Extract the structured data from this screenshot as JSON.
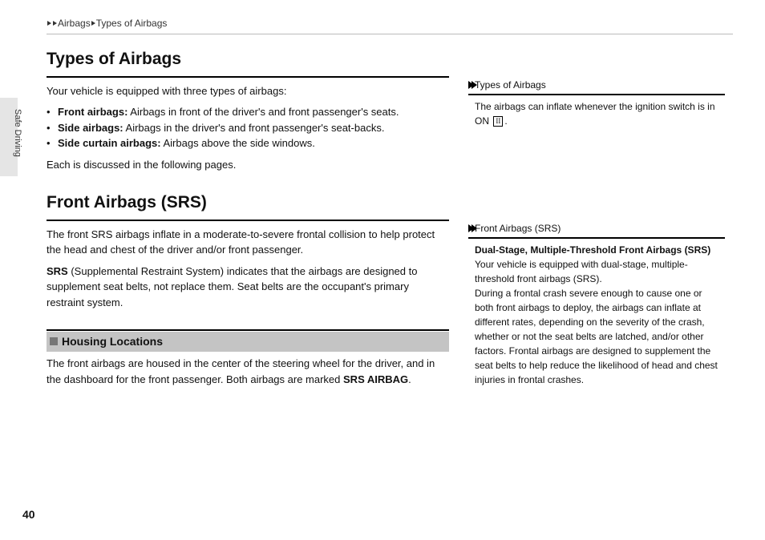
{
  "breadcrumb": {
    "item1": "Airbags",
    "item2": "Types of Airbags"
  },
  "sideTab": "Safe Driving",
  "pageNumber": "40",
  "main": {
    "section1": {
      "title": "Types of Airbags",
      "intro": "Your vehicle is equipped with three types of airbags:",
      "bullets": [
        {
          "label": "Front airbags:",
          "text": " Airbags in front of the driver's and front passenger's seats."
        },
        {
          "label": "Side airbags:",
          "text": " Airbags in the driver's and front passenger's seat-backs."
        },
        {
          "label": "Side curtain airbags:",
          "text": " Airbags above the side windows."
        }
      ],
      "outro": "Each is discussed in the following pages."
    },
    "section2": {
      "title": "Front Airbags (SRS)",
      "p1": "The front SRS airbags inflate in a moderate-to-severe frontal collision to help protect the head and chest of the driver and/or front passenger.",
      "p2_lead": "SRS",
      "p2_rest": " (Supplemental Restraint System) indicates that the airbags are designed to supplement seat belts, not replace them. Seat belts are the occupant's primary restraint system.",
      "sub1_title": "Housing Locations",
      "sub1_body_pre": "The front airbags are housed in the center of the steering wheel for the driver, and in the dashboard for the front passenger. Both airbags are marked ",
      "sub1_body_bold": "SRS AIRBAG",
      "sub1_body_post": "."
    }
  },
  "side": {
    "block1": {
      "title": "Types of Airbags",
      "body_pre": "The airbags can inflate whenever the ignition switch is in ON ",
      "on_symbol": "II",
      "body_post": "."
    },
    "block2": {
      "title": "Front Airbags (SRS)",
      "sub_bold": "Dual-Stage, Multiple-Threshold Front Airbags (SRS)",
      "p1": "Your vehicle is equipped with dual-stage, multiple-threshold front airbags (SRS).",
      "p2": "During a frontal crash severe enough to cause one or both front airbags to deploy, the airbags can inflate at different rates, depending on the severity of the crash, whether or not the seat belts are latched, and/or other factors. Frontal airbags are designed to supplement the seat belts to help reduce the likelihood of head and chest injuries in frontal crashes."
    }
  }
}
